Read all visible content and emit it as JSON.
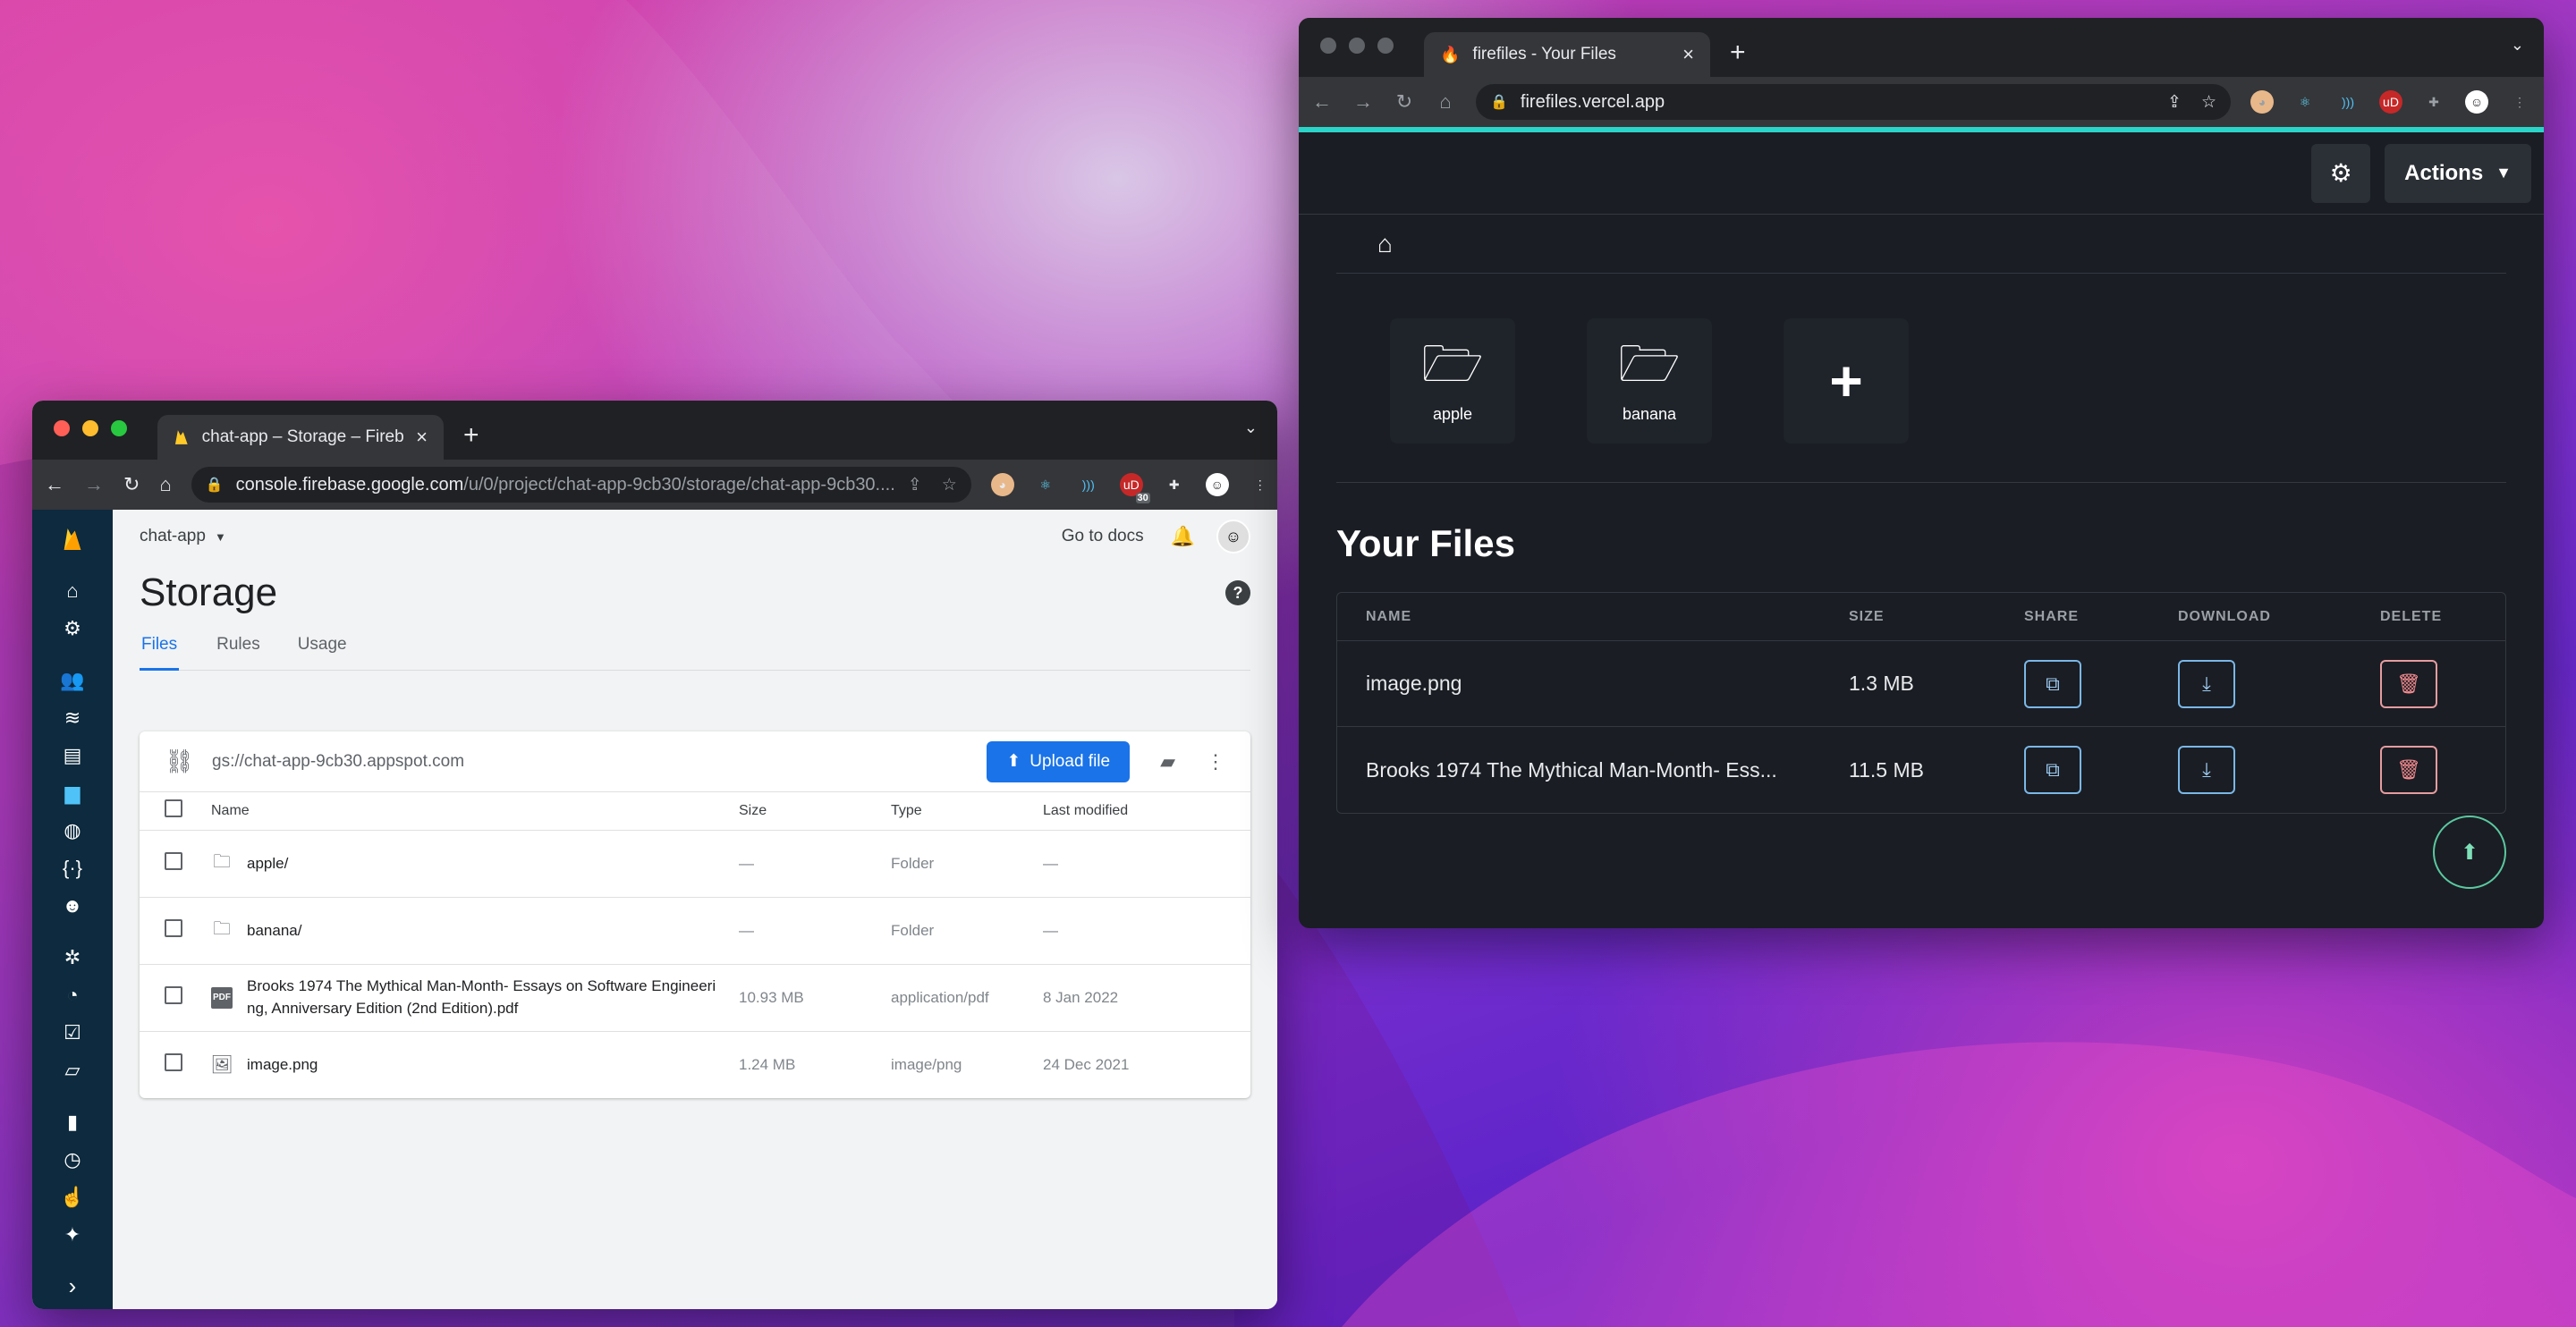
{
  "firebase": {
    "tab_title": "chat-app – Storage – Firebase",
    "url_host": "console.firebase.google.com",
    "url_path": "/u/0/project/chat-app-9cb30/storage/chat-app-9cb30....",
    "ext_badge": "30",
    "project": "chat-app",
    "docs_link": "Go to docs",
    "page_title": "Storage",
    "tabs": [
      "Files",
      "Rules",
      "Usage"
    ],
    "bucket": "gs://chat-app-9cb30.appspot.com",
    "upload_label": "Upload file",
    "columns": [
      "Name",
      "Size",
      "Type",
      "Last modified"
    ],
    "rows": [
      {
        "name": "apple/",
        "size": "—",
        "type": "Folder",
        "modified": "—",
        "icon": "folder-icon"
      },
      {
        "name": "banana/",
        "size": "—",
        "type": "Folder",
        "modified": "—",
        "icon": "folder-icon"
      },
      {
        "name": "Brooks 1974 The Mythical Man-Month- Essays on Software Engineering, Anniversary Edition (2nd Edition).pdf",
        "size": "10.93 MB",
        "type": "application/pdf",
        "modified": "8 Jan 2022",
        "icon": "pdf-icon"
      },
      {
        "name": "image.png",
        "size": "1.24 MB",
        "type": "image/png",
        "modified": "24 Dec 2021",
        "icon": "image-icon"
      }
    ]
  },
  "firefiles": {
    "tab_title": "firefiles - Your Files",
    "url": "firefiles.vercel.app",
    "actions_label": "Actions",
    "folders": [
      "apple",
      "banana"
    ],
    "section_title": "Your Files",
    "columns": [
      "NAME",
      "SIZE",
      "SHARE",
      "DOWNLOAD",
      "DELETE"
    ],
    "files": [
      {
        "name": "image.png",
        "size": "1.3 MB"
      },
      {
        "name": "Brooks 1974 The Mythical Man-Month- Ess...",
        "size": "11.5 MB"
      }
    ]
  },
  "colors": {
    "firebase_accent": "#1a73e8",
    "firefiles_progress": "#2bd4c8",
    "firefiles_bg": "#1a1d23"
  }
}
